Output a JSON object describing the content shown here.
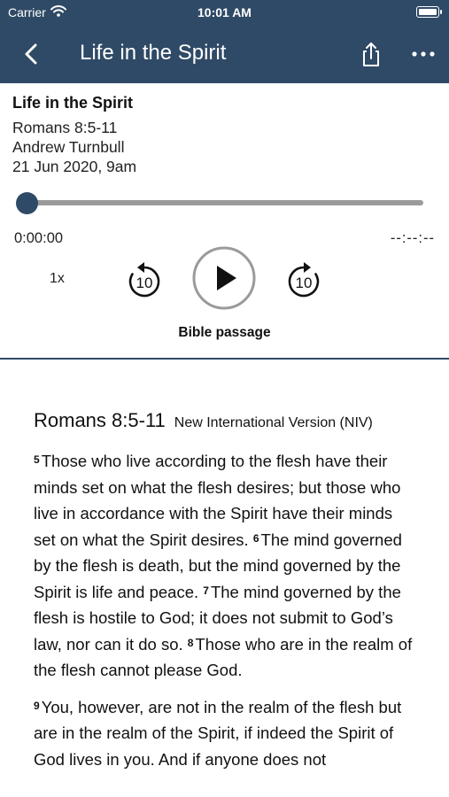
{
  "status_bar": {
    "carrier": "Carrier",
    "time": "10:01 AM"
  },
  "nav": {
    "title": "Life in the Spirit"
  },
  "episode": {
    "title": "Life in the Spirit",
    "passage": "Romans 8:5-11",
    "speaker": "Andrew Turnbull",
    "date": "21 Jun 2020, 9am"
  },
  "player": {
    "current_time": "0:00:00",
    "duration": "--:--:--",
    "progress": 0,
    "speed": "1x",
    "skip_back_seconds": "10",
    "skip_forward_seconds": "10",
    "section_label": "Bible passage"
  },
  "passage_text": {
    "reference": "Romans 8:5-11",
    "version": "New International Version (NIV)",
    "paragraphs": [
      [
        {
          "verse": "5",
          "text": "Those who live according to the flesh have their minds set on what the flesh desires; but those who live in accordance with the Spirit have their minds set on what the Spirit desires. "
        },
        {
          "verse": "6",
          "text": "The mind governed by the flesh is death, but the mind governed by the Spirit is life and peace. "
        },
        {
          "verse": "7",
          "text": "The mind governed by the flesh is hostile to God; it does not submit to God’s law, nor can it do so. "
        },
        {
          "verse": "8",
          "text": "Those who are in the realm of the flesh cannot please God."
        }
      ],
      [
        {
          "verse": "9",
          "text": "You, however, are not in the realm of the flesh but are in the realm of the Spirit, if indeed the Spirit of God lives in you. And if anyone does not"
        }
      ]
    ]
  },
  "colors": {
    "header": "#2f4a66",
    "accent": "#2f4a66",
    "track": "#9a9a9a"
  },
  "icons": [
    "wifi-icon",
    "battery-icon",
    "back-chevron-icon",
    "share-icon",
    "more-icon",
    "skip-back-icon",
    "play-icon",
    "skip-forward-icon"
  ]
}
